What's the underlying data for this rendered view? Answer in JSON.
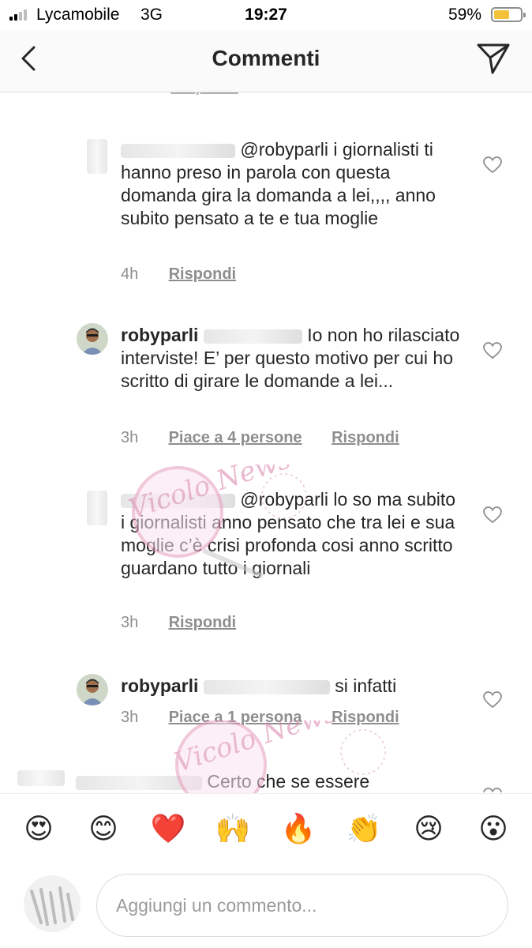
{
  "status_bar": {
    "carrier": "Lycamobile",
    "network": "3G",
    "time": "19:27",
    "battery": "59%",
    "battery_level": 0.59,
    "signal_bars": 2
  },
  "header": {
    "title": "Commenti",
    "back_icon": "chevron-left-icon",
    "send_icon": "paper-plane-icon"
  },
  "comments": [
    {
      "mention": "@robyparli",
      "text": "i giornalisti ti hanno  preso in parola  con questa domanda  gira la domanda  a lei,,,, anno subito pensato a te e tua moglie",
      "time": "4h",
      "likes": "",
      "reply": "Rispondi"
    },
    {
      "username": "robyparli",
      "text": "Io non ho rilasciato interviste! E’ per questo motivo per cui ho scritto di girare le domande a lei...",
      "time": "3h",
      "likes": "Piace a 4 persone",
      "reply": "Rispondi"
    },
    {
      "mention": "@robyparli",
      "text": "lo so  ma subito  i giornalisti  anno pensato che tra lei e sua  moglie  c’è crisi profonda  cosi anno scritto guardano tutto  i giornali",
      "time": "3h",
      "likes": "",
      "reply": "Rispondi"
    },
    {
      "username": "robyparli",
      "text": "si infatti",
      "time": "3h",
      "likes": "Piace a 1 persona",
      "reply": "Rispondi"
    },
    {
      "text": "Certo che se essere"
    }
  ],
  "emoji_bar": [
    "😍",
    "😊",
    "❤️",
    "🙌",
    "🔥",
    "👏",
    "😢",
    "😮"
  ],
  "composer": {
    "placeholder": "Aggiungi un commento..."
  },
  "watermark": {
    "text": "Vicolo News"
  },
  "colors": {
    "text": "#262626",
    "secondary": "#8e8e8e",
    "divider": "#dbdbdb",
    "battery": "#f4c23a"
  }
}
